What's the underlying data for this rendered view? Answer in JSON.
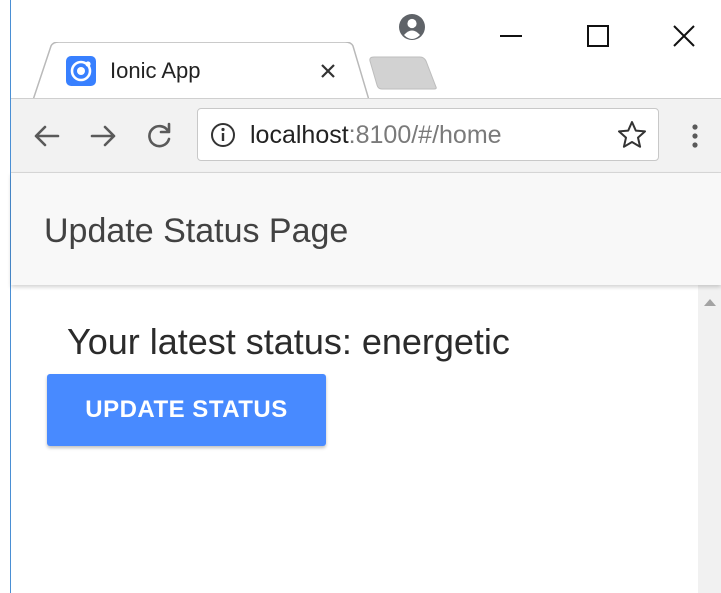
{
  "browser": {
    "tab_title": "Ionic App",
    "url_host": "localhost",
    "url_rest": ":8100/#/home",
    "icons": {
      "favicon": "ionic-logo-icon",
      "tab_close": "close-icon",
      "profile": "account-circle-icon",
      "minimize": "minimize-icon",
      "maximize": "maximize-icon",
      "close": "close-icon",
      "back": "arrow-left-icon",
      "forward": "arrow-right-icon",
      "reload": "reload-icon",
      "info": "info-circle-icon",
      "bookmark": "star-outline-icon",
      "menu": "vertical-dots-icon"
    },
    "colors": {
      "favicon": "#3880ff"
    }
  },
  "app": {
    "header_title": "Update Status Page",
    "status_text": "Your latest status: energetic",
    "update_button_label": "UPDATE STATUS",
    "colors": {
      "primary": "#488aff",
      "header_bg": "#f8f8f8"
    }
  }
}
